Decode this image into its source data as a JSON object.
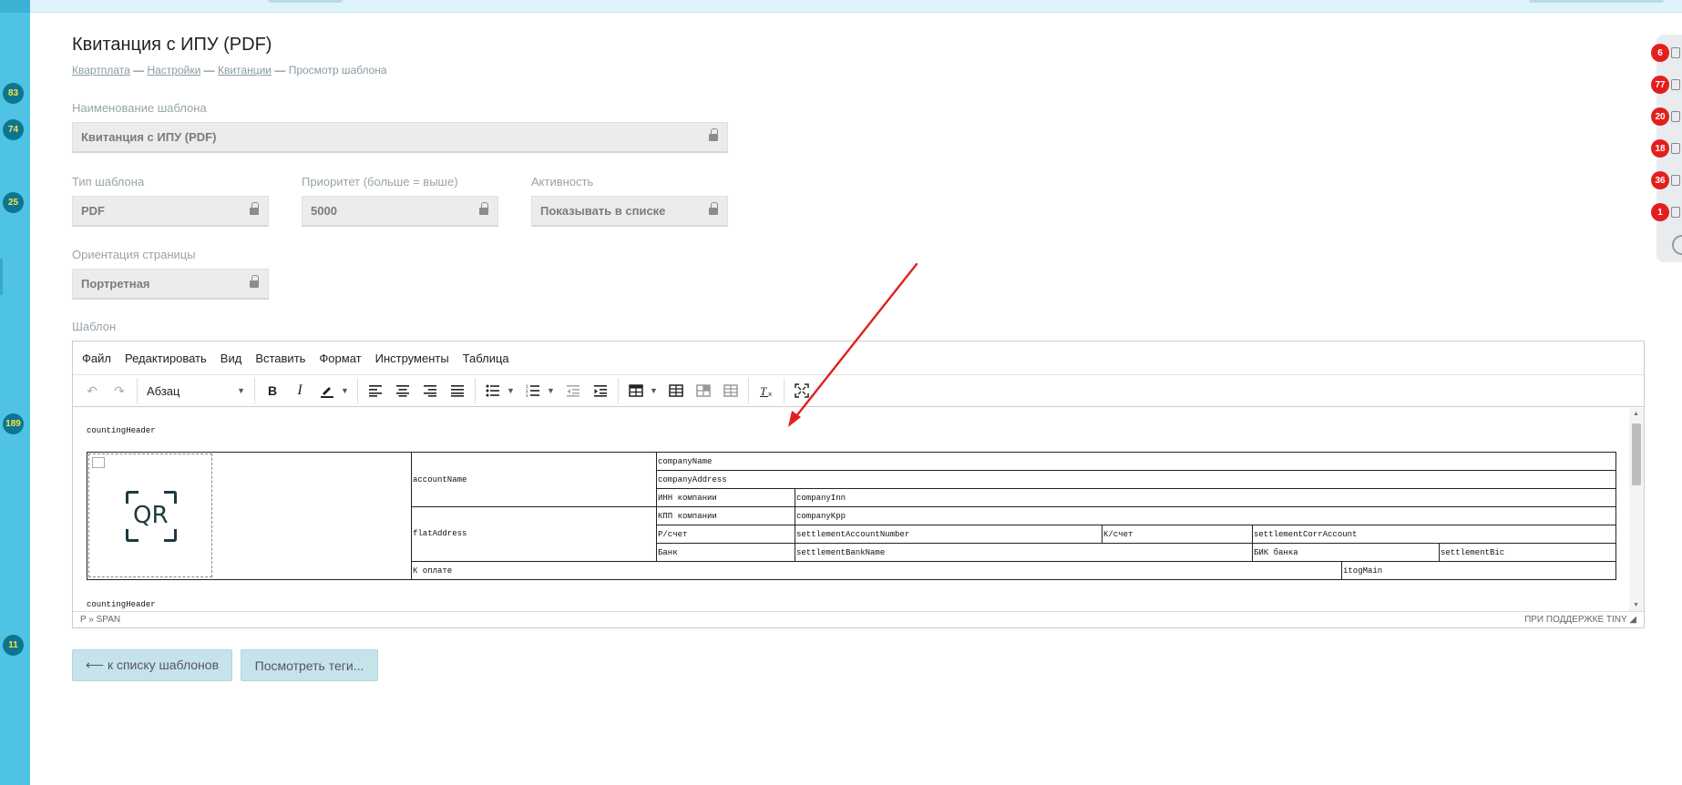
{
  "page": {
    "title": "Квитанция с ИПУ (PDF)",
    "breadcrumb": {
      "items": [
        "Квартплата",
        "Настройки",
        "Квитанции"
      ],
      "separator": "—",
      "current": "Просмотр шаблона"
    }
  },
  "sidebar": {
    "badges": [
      "83",
      "74",
      "25",
      "189",
      "11"
    ]
  },
  "right_rail": {
    "badges": [
      "6",
      "77",
      "20",
      "18",
      "36",
      "1"
    ]
  },
  "form": {
    "template_name": {
      "label": "Наименование шаблона",
      "value": "Квитанция с ИПУ (PDF)"
    },
    "template_type": {
      "label": "Тип шаблона",
      "value": "PDF"
    },
    "priority": {
      "label": "Приоритет (больше = выше)",
      "value": "5000"
    },
    "activity": {
      "label": "Активность",
      "value": "Показывать в списке"
    },
    "orientation": {
      "label": "Ориентация страницы",
      "value": "Портретная"
    },
    "template_label": "Шаблон"
  },
  "editor": {
    "menu": [
      "Файл",
      "Редактировать",
      "Вид",
      "Вставить",
      "Формат",
      "Инструменты",
      "Таблица"
    ],
    "format_select": "Абзац",
    "content": {
      "header1": "countingHeader",
      "header2": "countingHeader",
      "qr_text": "QR",
      "account_name": "accountName",
      "flat_address": "flatAddress",
      "company_name": "companyName",
      "company_address": "companyAddress",
      "inn_label": "ИНН компании",
      "inn_value": "companyInn",
      "kpp_label": "КПП компании",
      "kpp_value": "companyKpp",
      "rs_label": "Р/счет",
      "rs_value": "settlementAccountNumber",
      "ks_label": "К/счет",
      "ks_value": "settlementCorrAccount",
      "bank_label": "Банк",
      "bank_value": "settlementBankName",
      "bik_label": "БИК банка",
      "bik_value": "settlementBic",
      "pay_label": "К оплате",
      "pay_value": "itogMain"
    },
    "status_path": "P » SPAN",
    "status_brand": "ПРИ ПОДДЕРЖКЕ TINY"
  },
  "actions": {
    "back": "⟵ к списку шаблонов",
    "tags": "Посмотреть теги..."
  },
  "colors": {
    "sidebar": "#4ec3e3",
    "badge_dark": "#0e7590",
    "badge_text": "#f5e74a",
    "alert_red": "#e41e1e",
    "arrow_red": "#e0201c",
    "button_bg": "#c7e3ea"
  }
}
